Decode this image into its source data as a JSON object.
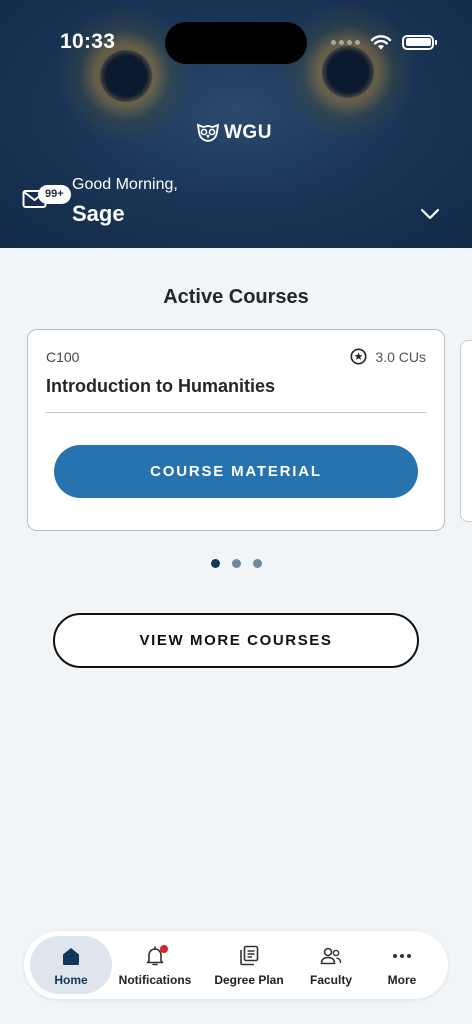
{
  "status_bar": {
    "time": "10:33"
  },
  "header": {
    "logo_text": "WGU",
    "mail_badge": "99+",
    "greeting": "Good Morning,",
    "user_name": "Sage"
  },
  "active_courses": {
    "title": "Active Courses",
    "card": {
      "code": "C100",
      "credits": "3.0 CUs",
      "name": "Introduction to Humanities",
      "button_label": "COURSE MATERIAL"
    },
    "page_count": 3,
    "active_page": 1
  },
  "view_more_label": "VIEW MORE COURSES",
  "bottom_nav": {
    "home": "Home",
    "notifications": "Notifications",
    "degree_plan": "Degree Plan",
    "faculty": "Faculty",
    "more": "More"
  },
  "colors": {
    "header_bg": "#1b3658",
    "primary_button": "#2673b0",
    "nav_active": "#12365b",
    "notification_dot": "#d0232a"
  }
}
